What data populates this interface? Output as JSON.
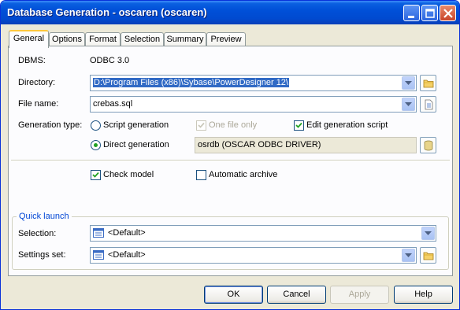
{
  "window": {
    "title": "Database Generation - oscaren (oscaren)"
  },
  "tabs": [
    {
      "label": "General",
      "active": true
    },
    {
      "label": "Options",
      "active": false
    },
    {
      "label": "Format",
      "active": false
    },
    {
      "label": "Selection",
      "active": false
    },
    {
      "label": "Summary",
      "active": false
    },
    {
      "label": "Preview",
      "active": false
    }
  ],
  "general": {
    "dbms_label": "DBMS:",
    "dbms_value": "ODBC 3.0",
    "directory_label": "Directory:",
    "directory_value": "D:\\Program Files (x86)\\Sybase\\PowerDesigner 12\\",
    "file_name_label": "File name:",
    "file_name_value": "crebas.sql",
    "generation_type_label": "Generation type:",
    "script_generation_label": "Script generation",
    "one_file_only_label": "One file only",
    "edit_generation_script_label": "Edit generation script",
    "direct_generation_label": "Direct generation",
    "datasource_value": "osrdb (OSCAR ODBC DRIVER)",
    "check_model_label": "Check model",
    "automatic_archive_label": "Automatic archive",
    "state": {
      "script_generation": false,
      "direct_generation": true,
      "one_file_only": true,
      "edit_generation_script": true,
      "check_model": true,
      "automatic_archive": false
    }
  },
  "quick_launch": {
    "title": "Quick launch",
    "selection_label": "Selection:",
    "selection_value": "<Default>",
    "settings_set_label": "Settings set:",
    "settings_set_value": "<Default>"
  },
  "buttons": {
    "ok": "OK",
    "cancel": "Cancel",
    "apply": "Apply",
    "help": "Help"
  },
  "colors": {
    "titlebar": "#0050d8",
    "selection_highlight": "#316ac5",
    "group_title": "#0046d5",
    "checkmark": "#21a121"
  }
}
